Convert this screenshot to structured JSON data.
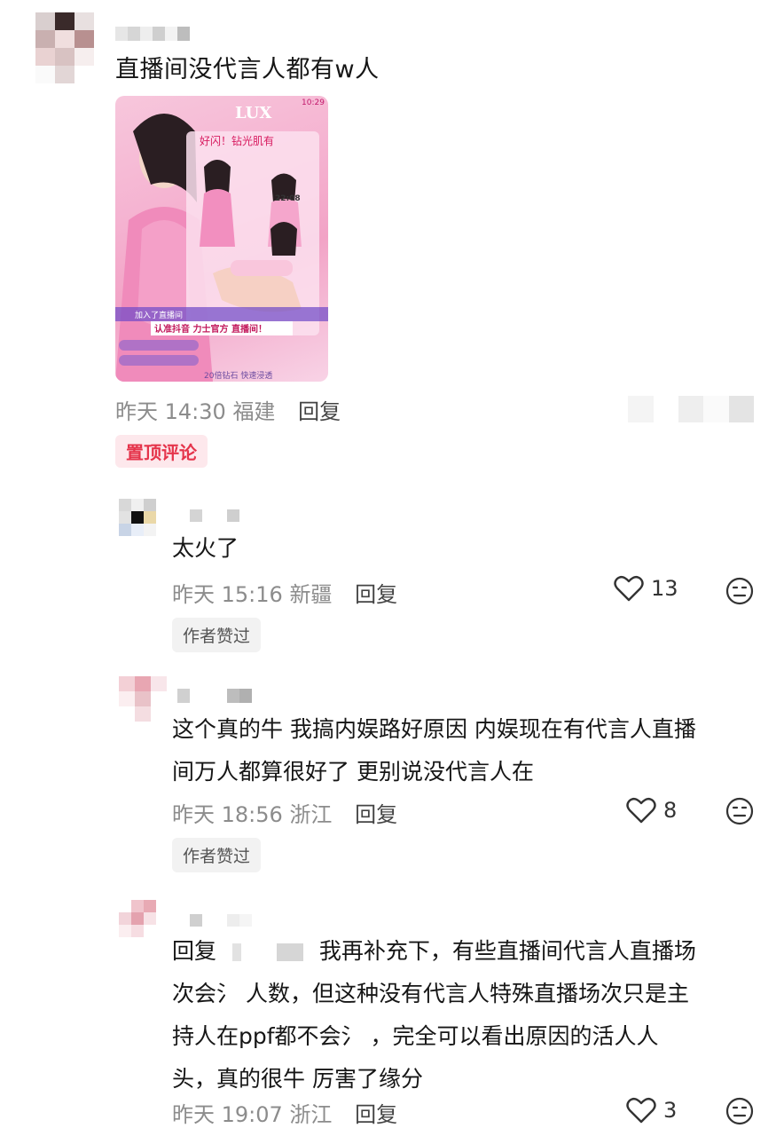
{
  "post": {
    "title": "直播间没代言人都有w人",
    "time": "昨天 14:30",
    "location": "福建",
    "reply_label": "回复",
    "image_texts": {
      "brand": "LUX",
      "headline": "好闪！钻光肌有",
      "clock_top": "10:29",
      "clock_mid": "22:08",
      "banner": "认准抖音 力士官方 直播间！",
      "join_notice": "加入了直播间",
      "bottom": "20倍钻石 快速浸透"
    }
  },
  "pinned_label": "置顶评论",
  "comments": [
    {
      "text": "太火了",
      "time": "昨天 15:16",
      "location": "新疆",
      "reply_label": "回复",
      "likes": "13",
      "author_liked": "作者赞过"
    },
    {
      "text_lines": [
        "这个真的牛 我搞内娱路好原因 内娱现在有代言人直播",
        "间万人都算很好了 更别说没代言人在"
      ],
      "time": "昨天 18:56",
      "location": "浙江",
      "reply_label": "回复",
      "likes": "8",
      "author_liked": "作者赞过"
    },
    {
      "reply_prefix": "回复",
      "text_lines": [
        "我再补充下，有些直播间代言人直播场",
        "次会氵 人数，但这种没有代言人特殊直播场次只是主",
        "持人在ppf都不会氵 ，完全可以看出原因的活人人",
        "头，真的很牛 厉害了缘分"
      ],
      "time": "昨天 19:07",
      "location": "浙江",
      "reply_label": "回复",
      "likes": "3"
    }
  ],
  "icons": [
    "heart-icon",
    "emoji-icon"
  ],
  "colors": {
    "pinned_text": "#e5344b",
    "pinned_bg": "#fde8ec",
    "meta": "#8c8c8c"
  }
}
